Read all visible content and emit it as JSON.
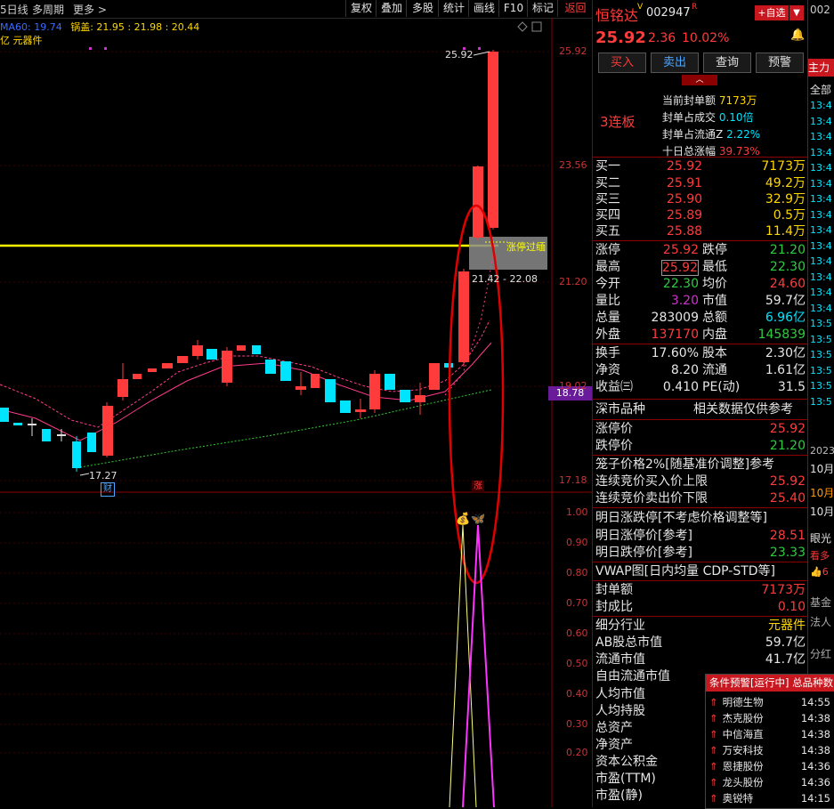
{
  "toolbar": {
    "period": "5日线",
    "multi_period": "多周期",
    "more": "更多 >",
    "buttons": [
      "复权",
      "叠加",
      "多股",
      "统计",
      "画线",
      "F10",
      "标记",
      "返回"
    ]
  },
  "chart": {
    "ma_line": "MA60: 19.74",
    "pot": "锅盖: 21.95 : 21.98 : 20.44",
    "sector": "亿 元器件",
    "y_ticks": [
      "25.92",
      "23.56",
      "21.20",
      "19.02",
      "17.18"
    ],
    "peak_label": "25.92",
    "low_label": "17.27",
    "range_label": "21.42 - 22.08",
    "limit_up_line_label": "涨停过缅",
    "side_price": "18.78",
    "cai_badge": "财",
    "zhang_badge": "涨",
    "lower_ticks": [
      "1.00",
      "0.90",
      "0.80",
      "0.70",
      "0.60",
      "0.50",
      "0.40",
      "0.30",
      "0.20"
    ]
  },
  "header": {
    "name": "恒铭达",
    "vote_mark": "V",
    "code": "002947",
    "r_mark": "R",
    "add_button": "+自选",
    "price": "25.92",
    "change": "2.36",
    "change_pct": "10.02%"
  },
  "actions": [
    "买入",
    "卖出",
    "查询",
    "预警"
  ],
  "limit_info": {
    "streak": "3连板",
    "items": [
      {
        "label": "当前封单额",
        "value": "7173万"
      },
      {
        "label": "封单占成交",
        "value": "0.10倍"
      },
      {
        "label": "封单占流通Z",
        "value": "2.22%"
      },
      {
        "label": "十日总涨幅",
        "value": "39.73%"
      }
    ]
  },
  "order_book": [
    {
      "label": "买一",
      "price": "25.92",
      "vol": "7173万"
    },
    {
      "label": "买二",
      "price": "25.91",
      "vol": "49.2万"
    },
    {
      "label": "买三",
      "price": "25.90",
      "vol": "32.9万"
    },
    {
      "label": "买四",
      "price": "25.89",
      "vol": "0.5万"
    },
    {
      "label": "买五",
      "price": "25.88",
      "vol": "11.4万"
    }
  ],
  "quote": [
    {
      "l1": "涨停",
      "v1": "25.92",
      "l2": "跌停",
      "v2": "21.20"
    },
    {
      "l1": "最高",
      "v1": "25.92",
      "l2": "最低",
      "v2": "22.30"
    },
    {
      "l1": "今开",
      "v1": "22.30",
      "l2": "均价",
      "v2": "24.60"
    },
    {
      "l1": "量比",
      "v1": "3.20",
      "l2": "市值",
      "v2": "59.7亿"
    },
    {
      "l1": "总量",
      "v1": "283009",
      "l2": "总额",
      "v2": "6.96亿"
    },
    {
      "l1": "外盘",
      "v1": "137170",
      "l2": "内盘",
      "v2": "145839"
    }
  ],
  "fundamentals": [
    {
      "l1": "换手",
      "v1": "17.60%",
      "l2": "股本",
      "v2": "2.30亿"
    },
    {
      "l1": "净资",
      "v1": "8.20",
      "l2": "流通",
      "v2": "1.61亿"
    },
    {
      "l1": "收益㈢",
      "v1": "0.410",
      "l2": "PE(动)",
      "v2": "31.5"
    }
  ],
  "market": {
    "title": "深市品种",
    "note": "相关数据仅供参考"
  },
  "limits": [
    {
      "label": "涨停价",
      "value": "25.92"
    },
    {
      "label": "跌停价",
      "value": "21.20"
    }
  ],
  "cage_title": "笼子价格2%[随基准价调整]参考",
  "cage": [
    {
      "label": "连续竞价买入价上限",
      "value": "25.92"
    },
    {
      "label": "连续竞价卖出价下限",
      "value": "25.40"
    }
  ],
  "tomorrow_title": "明日涨跌停[不考虑价格调整等]",
  "tomorrow": [
    {
      "label": "明日涨停价[参考]",
      "value": "28.51"
    },
    {
      "label": "明日跌停价[参考]",
      "value": "23.33"
    }
  ],
  "vwap_title": "VWAP图[日内均量 CDP-STD等]",
  "seal": [
    {
      "label": "封单额",
      "value": "7173万"
    },
    {
      "label": "封成比",
      "value": "0.10"
    }
  ],
  "industry": {
    "label": "细分行业",
    "value": "元器件"
  },
  "caps": [
    {
      "label": "AB股总市值",
      "value": "59.7亿"
    },
    {
      "label": "流通市值",
      "value": "41.7亿"
    },
    {
      "label": "自由流通市值",
      "value": ""
    }
  ],
  "more_fields": [
    "人均市值",
    "人均持股",
    "总资产",
    "净资产",
    "资本公积金",
    "市盈(TTM)",
    "市盈(静)"
  ],
  "strip": {
    "top": "002",
    "tab": "主力",
    "all": "全部",
    "times": [
      "13:4",
      "13:4",
      "13:4",
      "13:4",
      "13:4",
      "13:4",
      "13:4",
      "13:4",
      "13:4",
      "13:4",
      "13:4",
      "13:4",
      "13:4",
      "13:4",
      "13:5",
      "13:5",
      "13:5",
      "13:5",
      "13:5",
      "13:5"
    ],
    "year": "2023",
    "date1": "10月",
    "date2": "10月",
    "date3": "10月",
    "eye": "眼光",
    "see_more": "看多",
    "count": "6",
    "jijin": "基金",
    "faren": "法人",
    "fenhong": "分红"
  },
  "alert": {
    "title": "条件预警[运行中] 总品种数",
    "items": [
      {
        "name": "明德生物",
        "time": "14:55"
      },
      {
        "name": "杰克股份",
        "time": "14:38"
      },
      {
        "name": "中信海直",
        "time": "14:38"
      },
      {
        "name": "万安科技",
        "time": "14:38"
      },
      {
        "name": "恩捷股份",
        "time": "14:36"
      },
      {
        "name": "龙头股份",
        "time": "14:36"
      },
      {
        "name": "奥锐特",
        "time": "14:15"
      }
    ]
  },
  "colors": {
    "up": "#ff3b3b",
    "down": "#00e5ff",
    "limit_line": "#ffff00",
    "accent_border": "#8b0000"
  }
}
